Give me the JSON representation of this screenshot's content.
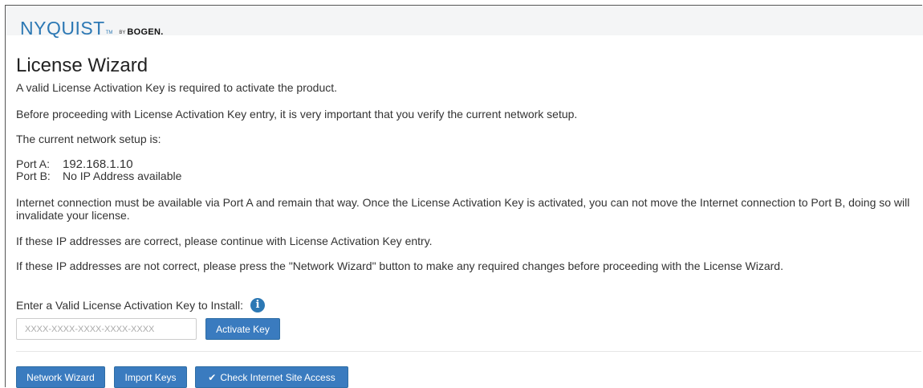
{
  "brand": {
    "name": "NYQUIST",
    "tm": "TM",
    "by": "BY",
    "partner": "BOGEN."
  },
  "page": {
    "title": "License Wizard",
    "intro": "A valid License Activation Key is required to activate the product.",
    "verify": "Before proceeding with License Activation Key entry, it is very important that you verify the current network setup.",
    "current_setup": "The current network setup is:",
    "internet_note": "Internet connection must be available via Port A and remain that way. Once the License Activation Key is activated, you can not move the Internet connection to Port B, doing so will invalidate your license.",
    "if_correct": "If these IP addresses are correct, please continue with License Activation Key entry.",
    "if_not_correct": "If these IP addresses are not correct, please press the \"Network Wizard\" button to make any required changes before proceeding with the License Wizard."
  },
  "ports": [
    {
      "label": "Port A:",
      "value": "192.168.1.10"
    },
    {
      "label": "Port B:",
      "value": "No IP Address available"
    }
  ],
  "key_entry": {
    "label": "Enter a Valid License Activation Key to Install:",
    "info_icon": "info-circle-icon",
    "placeholder": "XXXX-XXXX-XXXX-XXXX-XXXX",
    "value": "",
    "activate_button": "Activate Key"
  },
  "footer_buttons": {
    "network_wizard": "Network Wizard",
    "import_keys": "Import Keys",
    "check_internet": "Check Internet Site Access",
    "check_icon": "checkmark-icon"
  },
  "colors": {
    "accent": "#3a7bbf",
    "brand_blue": "#2c78b4",
    "header_bg": "#f4f5f6"
  }
}
